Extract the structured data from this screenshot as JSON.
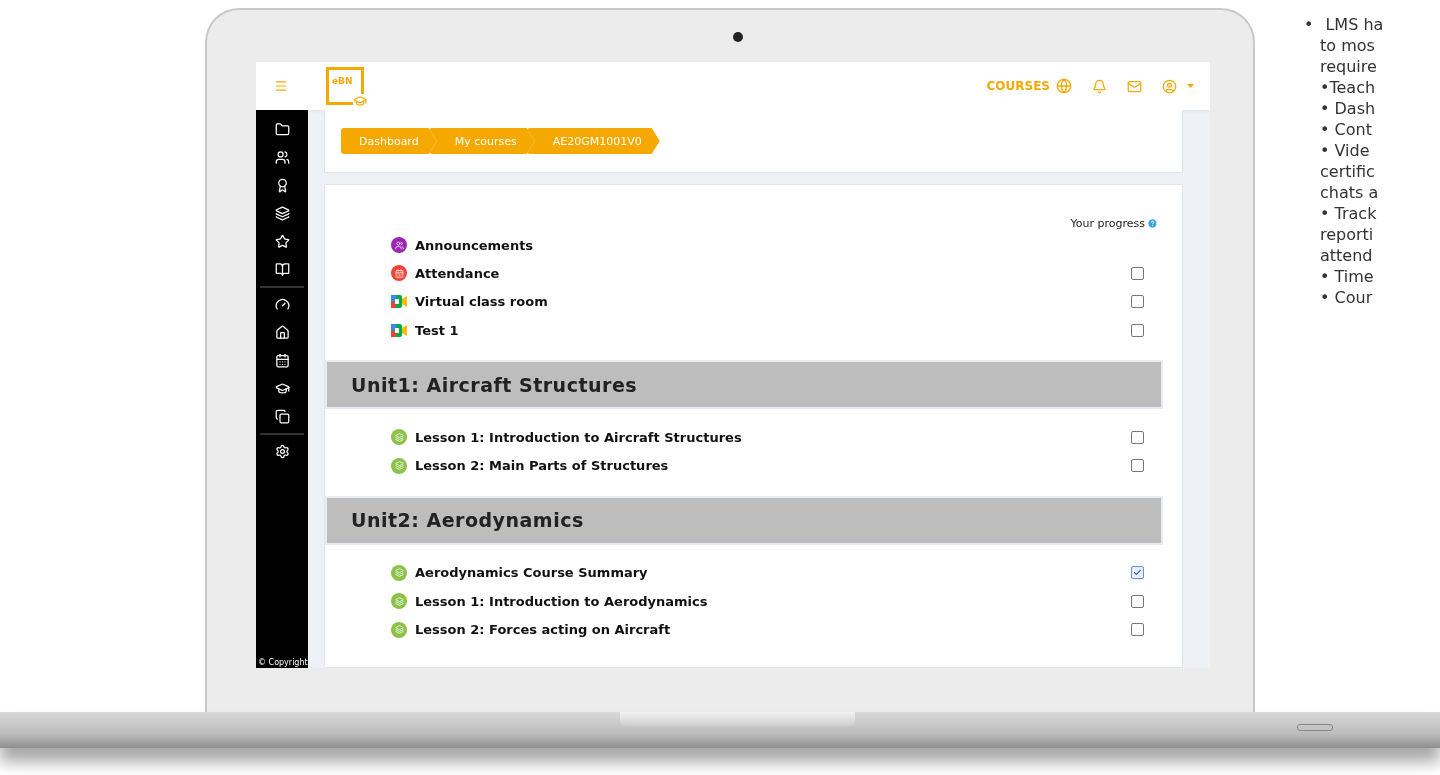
{
  "topbar": {
    "logo": "eBN",
    "courses_link": "COURSES"
  },
  "sidebar": {
    "footer": "© Copyright"
  },
  "breadcrumb": [
    {
      "label": "Dashboard"
    },
    {
      "label": "My courses"
    },
    {
      "label": "AE20GM1001V0"
    }
  ],
  "progress_label": "Your progress",
  "intro": [
    {
      "kind": "forum",
      "title": "Announcements",
      "tracked": false
    },
    {
      "kind": "attendance",
      "title": "Attendance",
      "tracked": true,
      "checked": false
    },
    {
      "kind": "meeting",
      "title": "Virtual class room",
      "tracked": true,
      "checked": false
    },
    {
      "kind": "meeting",
      "title": "Test 1",
      "tracked": true,
      "checked": false
    }
  ],
  "sections": [
    {
      "title": "Unit1: Aircraft Structures",
      "activities": [
        {
          "kind": "lesson",
          "title": "Lesson 1: Introduction to Aircraft Structures",
          "tracked": true,
          "checked": false
        },
        {
          "kind": "lesson",
          "title": "Lesson 2: Main Parts of Structures",
          "tracked": true,
          "checked": false
        }
      ]
    },
    {
      "title": "Unit2: Aerodynamics",
      "activities": [
        {
          "kind": "lesson",
          "title": "Aerodynamics Course Summary",
          "tracked": true,
          "checked": true
        },
        {
          "kind": "lesson",
          "title": "Lesson 1: Introduction to Aerodynamics",
          "tracked": true,
          "checked": false
        },
        {
          "kind": "lesson",
          "title": "Lesson 2: Forces acting on Aircraft",
          "tracked": true,
          "checked": false
        }
      ]
    }
  ],
  "side_text": [
    {
      "text": "LMS ha",
      "bullet": "•"
    },
    {
      "text": "to mos"
    },
    {
      "text": "require"
    },
    {
      "text": "•Teach"
    },
    {
      "text": "• Dash"
    },
    {
      "text": "• Cont"
    },
    {
      "text": "• Vide"
    },
    {
      "text": "certific"
    },
    {
      "text": "chats a"
    },
    {
      "text": "• Track"
    },
    {
      "text": "reporti"
    },
    {
      "text": "attend"
    },
    {
      "text": "• Time"
    },
    {
      "text": "• Cour"
    }
  ]
}
